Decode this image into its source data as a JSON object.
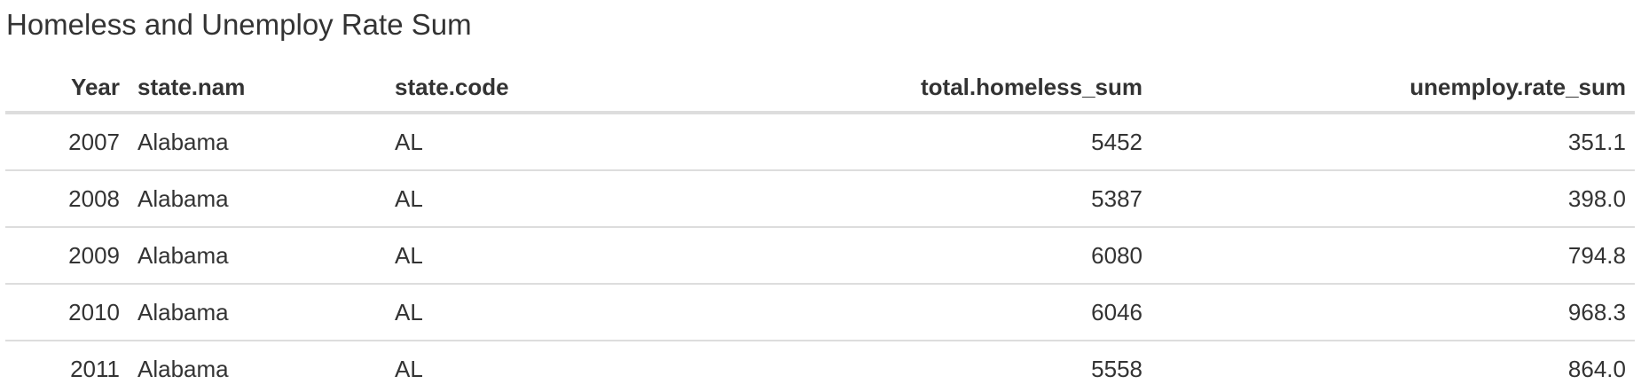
{
  "title": "Homeless and Unemploy Rate Sum",
  "table": {
    "headers": {
      "year": "Year",
      "state_nam": "state.nam",
      "state_code": "state.code",
      "total_homeless_sum": "total.homeless_sum",
      "unemploy_rate_sum": "unemploy.rate_sum"
    },
    "rows": [
      {
        "year": "2007",
        "state_nam": "Alabama",
        "state_code": "AL",
        "total_homeless_sum": "5452",
        "unemploy_rate_sum": "351.1"
      },
      {
        "year": "2008",
        "state_nam": "Alabama",
        "state_code": "AL",
        "total_homeless_sum": "5387",
        "unemploy_rate_sum": "398.0"
      },
      {
        "year": "2009",
        "state_nam": "Alabama",
        "state_code": "AL",
        "total_homeless_sum": "6080",
        "unemploy_rate_sum": "794.8"
      },
      {
        "year": "2010",
        "state_nam": "Alabama",
        "state_code": "AL",
        "total_homeless_sum": "6046",
        "unemploy_rate_sum": "968.3"
      },
      {
        "year": "2011",
        "state_nam": "Alabama",
        "state_code": "AL",
        "total_homeless_sum": "5558",
        "unemploy_rate_sum": "864.0"
      }
    ]
  }
}
